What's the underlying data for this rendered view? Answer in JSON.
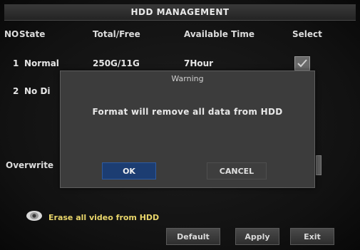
{
  "window": {
    "title": "HDD  MANAGEMENT"
  },
  "table": {
    "headers": [
      "NO",
      "State",
      "Total/Free",
      "Available  Time",
      "Select"
    ],
    "rows": [
      {
        "no": "1",
        "state": "Normal",
        "total_free": "250G/11G",
        "available_time": "7Hour",
        "selected": true
      },
      {
        "no": "2",
        "state": "No Di"
      }
    ]
  },
  "overwrite": {
    "label": "Overwrite"
  },
  "dialog": {
    "title": "Warning",
    "message": "Format  will  remove  all  data  from  HDD",
    "ok_label": "OK",
    "cancel_label": "CANCEL"
  },
  "hint": {
    "icon": "eye-icon",
    "text": "Erase  all  video  from  HDD",
    "color": "#e8d56a"
  },
  "footer": {
    "default_label": "Default",
    "apply_label": "Apply",
    "exit_label": "Exit"
  },
  "colors": {
    "ok_button": "#1c3d72",
    "dialog_bg": "#3c3c3c"
  }
}
